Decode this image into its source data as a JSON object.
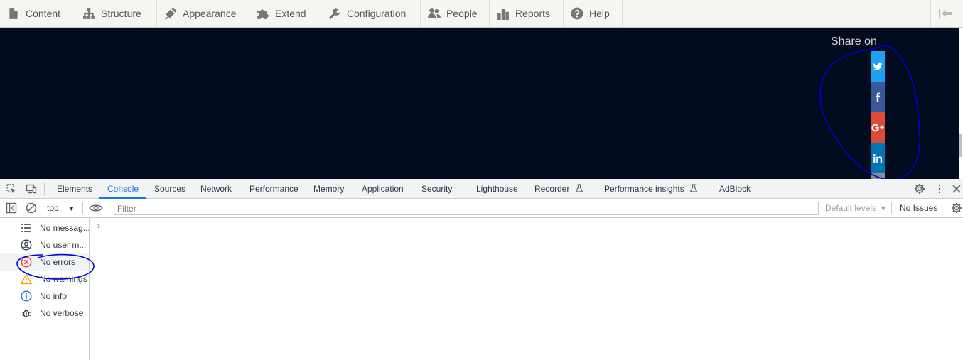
{
  "admin_toolbar": {
    "items": [
      {
        "label": "Content",
        "icon": "file-icon"
      },
      {
        "label": "Structure",
        "icon": "sitemap-icon"
      },
      {
        "label": "Appearance",
        "icon": "paint-icon"
      },
      {
        "label": "Extend",
        "icon": "puzzle-icon"
      },
      {
        "label": "Configuration",
        "icon": "wrench-icon"
      },
      {
        "label": "People",
        "icon": "people-icon"
      },
      {
        "label": "Reports",
        "icon": "bar-chart-icon"
      },
      {
        "label": "Help",
        "icon": "help-icon"
      }
    ],
    "collapse_icon": "collapse-left-icon"
  },
  "page": {
    "background": "#020c1e",
    "share": {
      "title": "Share on",
      "buttons": [
        {
          "network": "twitter",
          "icon": "twitter-icon",
          "color": "#1da1f2"
        },
        {
          "network": "facebook",
          "icon": "facebook-icon",
          "color": "#3b5998"
        },
        {
          "network": "google-plus",
          "icon": "google-plus-icon",
          "color": "#dd4b39"
        },
        {
          "network": "linkedin",
          "icon": "linkedin-icon",
          "color": "#0077b5"
        }
      ]
    }
  },
  "devtools": {
    "tabs": [
      {
        "label": "Elements"
      },
      {
        "label": "Console",
        "active": true
      },
      {
        "label": "Sources"
      },
      {
        "label": "Network"
      },
      {
        "label": "Performance"
      },
      {
        "label": "Memory"
      },
      {
        "label": "Application"
      },
      {
        "label": "Security"
      },
      {
        "label": "Lighthouse"
      },
      {
        "label": "Recorder",
        "icon": "flask-icon"
      },
      {
        "label": "Performance insights",
        "icon": "flask-icon"
      },
      {
        "label": "AdBlock"
      }
    ],
    "toolbar": {
      "context": "top",
      "filter_placeholder": "Filter",
      "levels": "Default levels",
      "issues": "No Issues"
    },
    "sidebar": [
      {
        "label": "No messag...",
        "icon": "list-icon"
      },
      {
        "label": "No user m...",
        "icon": "user-icon"
      },
      {
        "label": "No errors",
        "icon": "error-icon",
        "selected": true
      },
      {
        "label": "No warnings",
        "icon": "warning-icon"
      },
      {
        "label": "No info",
        "icon": "info-icon"
      },
      {
        "label": "No verbose",
        "icon": "bug-icon"
      }
    ],
    "prompt": "›",
    "accent": "#1a73e8"
  },
  "annotation_color": "#0000dd"
}
